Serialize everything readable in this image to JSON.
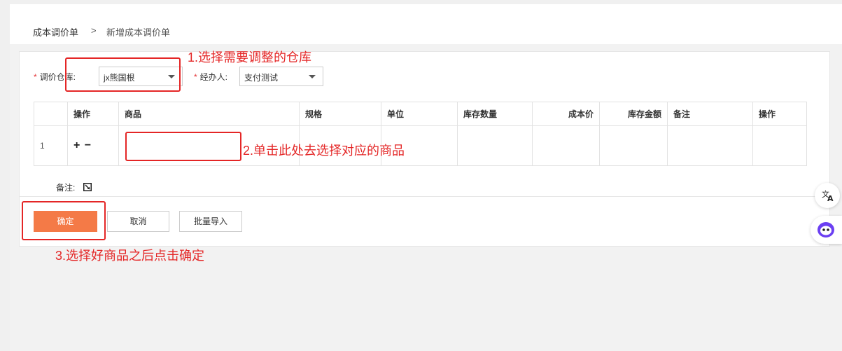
{
  "breadcrumb": {
    "root": "成本调价单",
    "separator": ">",
    "current": "新增成本调价单"
  },
  "form": {
    "warehouse_label": "调价仓库:",
    "warehouse_value": "jx熊国根",
    "handler_label": "经办人:",
    "handler_value": "支付测试",
    "required_mark": "*"
  },
  "table": {
    "headers": [
      "",
      "操作",
      "商品",
      "规格",
      "单位",
      "库存数量",
      "成本价",
      "库存金额",
      "备注",
      "操作"
    ],
    "rows": [
      {
        "index": "1",
        "ops": "+ −",
        "product": "",
        "spec": "",
        "unit": "",
        "stock_qty": "",
        "cost": "",
        "stock_amount": "",
        "remark": "",
        "op": ""
      }
    ]
  },
  "remark_label": "备注:",
  "buttons": {
    "confirm": "确定",
    "cancel": "取消",
    "import": "批量导入"
  },
  "annotations": {
    "step1": "1.选择需要调整的仓库",
    "step2": "2.单击此处去选择对应的商品",
    "step3": "3.选择好商品之后点击确定"
  },
  "colors": {
    "primary": "#f47a47",
    "annotation": "#e42626"
  },
  "float_icons": [
    "translate-icon",
    "assistant-icon"
  ]
}
